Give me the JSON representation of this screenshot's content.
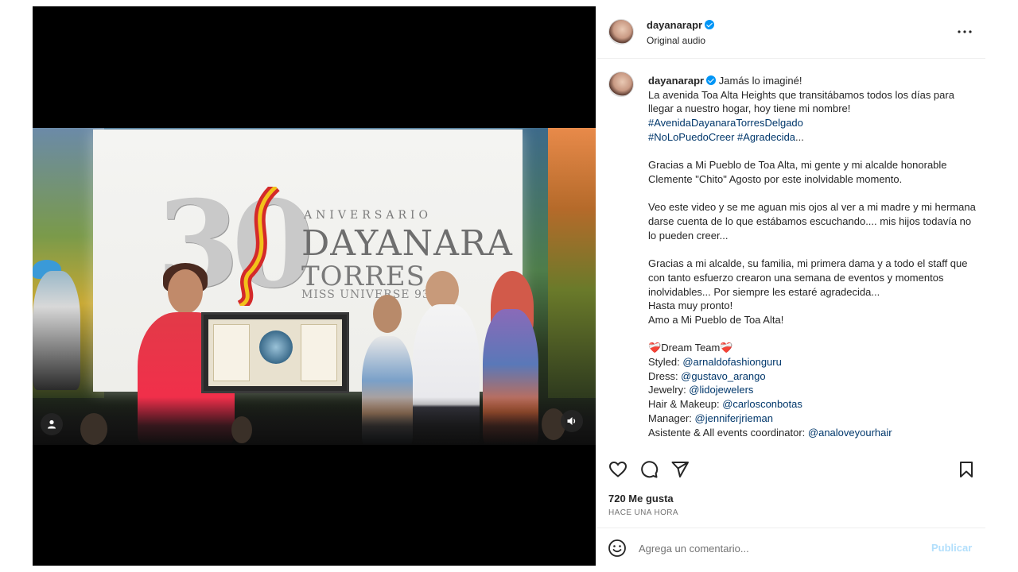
{
  "post": {
    "username": "dayanarapr",
    "audio": "Original audio",
    "more_icon": "more-horizontal-icon",
    "verified_icon": "verified-badge-icon"
  },
  "video": {
    "screen_text": {
      "number": "30",
      "aniversario": "ANIVERSARIO",
      "name": "DAYANARA",
      "surname": "TORRES",
      "title": "MISS UNIVERSE 93'"
    },
    "user_tag_icon": "person-icon",
    "audio_icon": "speaker-icon"
  },
  "caption": {
    "username": "dayanarapr",
    "lines": [
      "Jamás lo imaginé!",
      "La avenida Toa Alta Heights que transitábamos todos los días para llegar a nuestro hogar, hoy tiene mi nombre!"
    ],
    "hashtags": [
      "#AvenidaDayanaraTorresDelgado",
      "#NoLoPuedoCreer",
      "#Agradecida"
    ],
    "hashtag_suffix": "...",
    "para1": "Gracias a Mi Pueblo de Toa Alta, mi gente y mi alcalde honorable Clemente \"Chito\" Agosto por este inolvidable momento.",
    "para2": "Veo este video y se me aguan mis ojos al ver a mi madre y mi hermana darse cuenta de lo que estábamos escuchando.... mis hijos todavía no lo pueden creer...",
    "para3_a": "Gracias a mi alcalde, su familia, mi primera dama y a todo el staff que con tanto esfuerzo crearon una semana de eventos y momentos inolvidables... Por siempre les estaré agradecida...",
    "para3_b": "Hasta muy pronto!",
    "para3_c": "Amo a Mi Pueblo de Toa Alta!",
    "team_title": "Dream Team",
    "team_heart": "❤️‍🩹",
    "credits": [
      {
        "label": "Styled: ",
        "handle": "@arnaldofashionguru"
      },
      {
        "label": "Dress: ",
        "handle": "@gustavo_arango"
      },
      {
        "label": "Jewelry: ",
        "handle": "@lidojewelers"
      },
      {
        "label": "Hair & Makeup: ",
        "handle": "@carlosconbotas"
      },
      {
        "label": "Manager: ",
        "handle": "@jenniferjrieman"
      },
      {
        "label": "Asistente & All events coordinator: ",
        "handle": "@analoveyourhair"
      }
    ]
  },
  "actions": {
    "like_icon": "heart-icon",
    "comment_icon": "comment-icon",
    "share_icon": "send-icon",
    "save_icon": "bookmark-icon"
  },
  "stats": {
    "likes": "720 Me gusta",
    "time": "HACE UNA HORA"
  },
  "comment": {
    "emoji_icon": "emoji-icon",
    "placeholder": "Agrega un comentario...",
    "post_label": "Publicar"
  },
  "colors": {
    "link": "#00376b",
    "verified": "#0095f6",
    "post_disabled": "#b2dffc",
    "secondary_text": "#737373"
  }
}
